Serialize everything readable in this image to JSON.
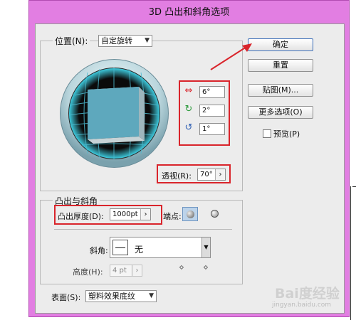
{
  "dialog": {
    "title": "3D 凸出和斜角选项"
  },
  "position": {
    "label": "位置(N):",
    "value": "自定旋转",
    "rotation_x": "6°",
    "rotation_y": "2°",
    "rotation_z": "1°",
    "perspective_label": "透视(R):",
    "perspective_value": "70°"
  },
  "buttons": {
    "ok": "确定",
    "reset": "重置",
    "map": "贴图(M)...",
    "more": "更多选项(O)",
    "preview": "预览(P)"
  },
  "extrude": {
    "legend": "凸出与斜角",
    "depth_label": "凸出厚度(D):",
    "depth_value": "1000pt",
    "cap_label": "端点:",
    "bevel_label": "斜角:",
    "bevel_value": "无",
    "height_label": "高度(H):",
    "height_value": "4 pt"
  },
  "surface": {
    "label": "表面(S):",
    "value": "塑料效果底纹"
  },
  "watermark": {
    "line1": "Bai度经验",
    "line2": "jingyan.baidu.com"
  }
}
